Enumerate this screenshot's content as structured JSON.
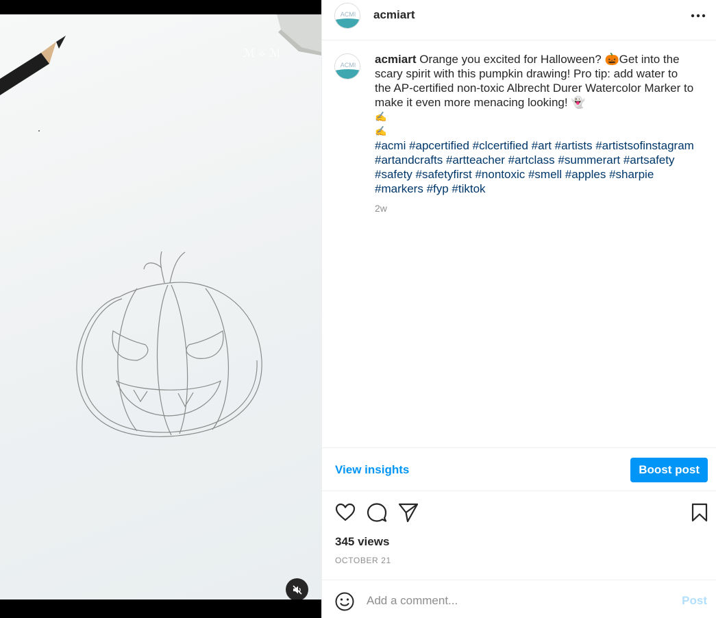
{
  "post": {
    "username": "acmiart",
    "avatar_text": "ACMI",
    "caption_text": "Orange you excited for Halloween? 🎃Get into the scary spirit with this pumpkin drawing! Pro tip: add water to the AP-certified non-toxic Albrecht Durer Watercolor Marker to make it even more menacing looking! 👻",
    "emoji_line_1": "✍️",
    "emoji_line_2": "✍️",
    "hashtags": "#acmi #apcertified #clcertified #art #artists #artistsofinstagram #artandcrafts #artteacher #artclass #summerart #artsafety #safety #safetyfirst #nontoxic #smell #apples #sharpie #markers #fyp #tiktok",
    "time_ago": "2w",
    "views": "345 views",
    "date": "OCTOBER 21"
  },
  "insights": {
    "view_label": "View insights",
    "boost_label": "Boost post"
  },
  "comment": {
    "placeholder": "Add a comment...",
    "post_label": "Post"
  },
  "icons": {
    "more": "more-options-icon",
    "like": "heart-icon",
    "comment": "comment-icon",
    "share": "send-icon",
    "save": "bookmark-icon",
    "emoji": "emoji-icon",
    "mute": "muted-speaker-icon"
  },
  "colors": {
    "accent": "#0095f6",
    "link": "#00376b",
    "muted": "#8e8e8e",
    "post_disabled": "#b2dffc"
  }
}
